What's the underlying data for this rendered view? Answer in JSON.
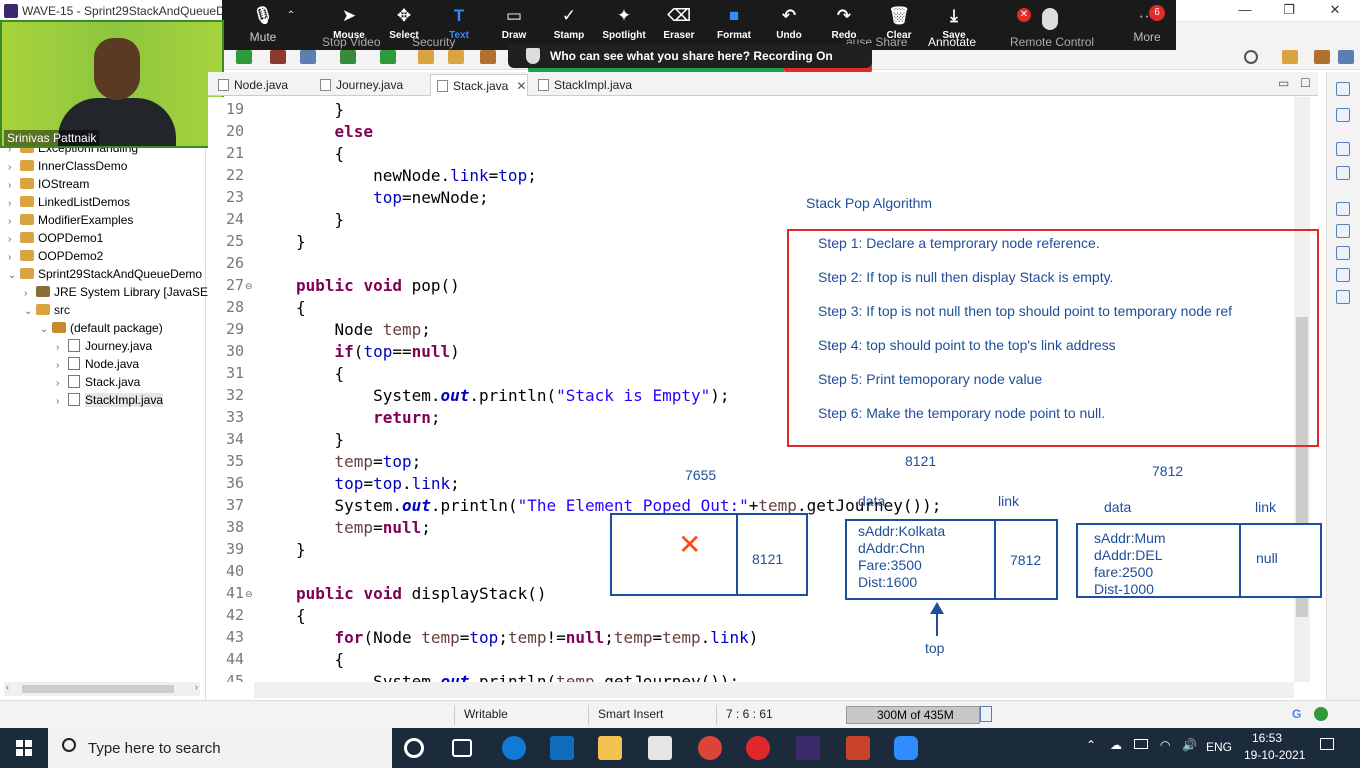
{
  "window": {
    "title": "WAVE-15 - Sprint29StackAndQueueDe",
    "minimize": "—",
    "restore": "❐",
    "close": "✕"
  },
  "zoom_toolbar": {
    "mute": {
      "label": "Mute",
      "icon": "microphone-icon"
    },
    "tools": [
      {
        "label": "Mouse",
        "icon": "cursor-icon"
      },
      {
        "label": "Select",
        "icon": "move-icon"
      },
      {
        "label": "Text",
        "icon": "text-icon"
      },
      {
        "label": "Draw",
        "icon": "rectangle-icon"
      },
      {
        "label": "Stamp",
        "icon": "check-icon"
      },
      {
        "label": "Spotlight",
        "icon": "wand-icon"
      },
      {
        "label": "Eraser",
        "icon": "eraser-icon"
      },
      {
        "label": "Format",
        "icon": "format-icon"
      },
      {
        "label": "Undo",
        "icon": "undo-icon"
      },
      {
        "label": "Redo",
        "icon": "redo-icon"
      },
      {
        "label": "Clear",
        "icon": "trash-icon"
      },
      {
        "label": "Save",
        "icon": "download-icon"
      }
    ],
    "more": {
      "label": "More",
      "badge": "6"
    },
    "behind_labels": [
      "Stop Video",
      "Security",
      "ause Share",
      "Annotate",
      "Remote Control"
    ],
    "notice": "Who can see what you share here? Recording On",
    "stop_share": "hare",
    "accent_color": "#2d8cff"
  },
  "webcam": {
    "participant": "Srinivas Pattnaik"
  },
  "explorer": {
    "items": [
      {
        "label": "ExceptionHandling",
        "indent": 0,
        "arrow": "›",
        "icon": "project"
      },
      {
        "label": "InnerClassDemo",
        "indent": 0,
        "arrow": "›",
        "icon": "project"
      },
      {
        "label": "IOStream",
        "indent": 0,
        "arrow": "›",
        "icon": "project"
      },
      {
        "label": "LinkedListDemos",
        "indent": 0,
        "arrow": "›",
        "icon": "project"
      },
      {
        "label": "ModifierExamples",
        "indent": 0,
        "arrow": "›",
        "icon": "project"
      },
      {
        "label": "OOPDemo1",
        "indent": 0,
        "arrow": "›",
        "icon": "project"
      },
      {
        "label": "OOPDemo2",
        "indent": 0,
        "arrow": "›",
        "icon": "project"
      },
      {
        "label": "Sprint29StackAndQueueDemo",
        "indent": 0,
        "arrow": "⌄",
        "icon": "project"
      },
      {
        "label": "JRE System Library [JavaSE-",
        "indent": 1,
        "arrow": "›",
        "icon": "library"
      },
      {
        "label": "src",
        "indent": 1,
        "arrow": "⌄",
        "icon": "folder"
      },
      {
        "label": "(default package)",
        "indent": 2,
        "arrow": "⌄",
        "icon": "package"
      },
      {
        "label": "Journey.java",
        "indent": 3,
        "arrow": "›",
        "icon": "java"
      },
      {
        "label": "Node.java",
        "indent": 3,
        "arrow": "›",
        "icon": "java"
      },
      {
        "label": "Stack.java",
        "indent": 3,
        "arrow": "›",
        "icon": "java"
      },
      {
        "label": "StackImpl.java",
        "indent": 3,
        "arrow": "›",
        "icon": "java",
        "selected": true
      }
    ]
  },
  "tabs": [
    {
      "label": "Node.java"
    },
    {
      "label": "Journey.java"
    },
    {
      "label": "Stack.java",
      "active": true,
      "close": "✕"
    },
    {
      "label": "StackImpl.java"
    }
  ],
  "editor": {
    "line_numbers": [
      "19",
      "20",
      "21",
      "22",
      "23",
      "24",
      "25",
      "26",
      "27",
      "28",
      "29",
      "30",
      "31",
      "32",
      "33",
      "34",
      "35",
      "36",
      "37",
      "38",
      "39",
      "40",
      "41",
      "42",
      "43",
      "44",
      "45"
    ],
    "fold_markers": {
      "27": "⊖",
      "41": "⊖"
    }
  },
  "annotation": {
    "heading": "Stack Pop Algorithm",
    "steps": [
      "Step 1: Declare a temprorary node reference.",
      "Step 2: If top is null then display Stack is empty.",
      "Step 3: If top is not null then top should point to temporary node ref",
      "Step 4: top should point to the top's link address",
      "Step 5: Print temoporary node value",
      "Step 6: Make the temporary node point to null."
    ],
    "addr1": "7655",
    "addr2": "8121",
    "addr3": "7812",
    "data_label": "data",
    "link_label": "link",
    "node1": {
      "mark": "✕",
      "link": "8121"
    },
    "node2": {
      "lines": [
        "sAddr:Kolkata",
        "dAddr:Chn",
        "Fare:3500",
        "Dist:1600"
      ],
      "link": "7812"
    },
    "node3": {
      "lines": [
        "sAddr:Mum",
        "dAddr:DEL",
        "fare:2500",
        "Dist-1000"
      ],
      "link": "null"
    },
    "top_label": "top",
    "box_color": "#e0282a",
    "ink_color": "#1f4e9a"
  },
  "statusbar": {
    "mode": "Writable",
    "insert": "Smart Insert",
    "position": "7 : 6 : 61",
    "heap": "300M of 435M"
  },
  "taskbar": {
    "search_placeholder": "Type here to search",
    "language": "ENG",
    "time": "16:53",
    "date": "19-10-2021"
  }
}
